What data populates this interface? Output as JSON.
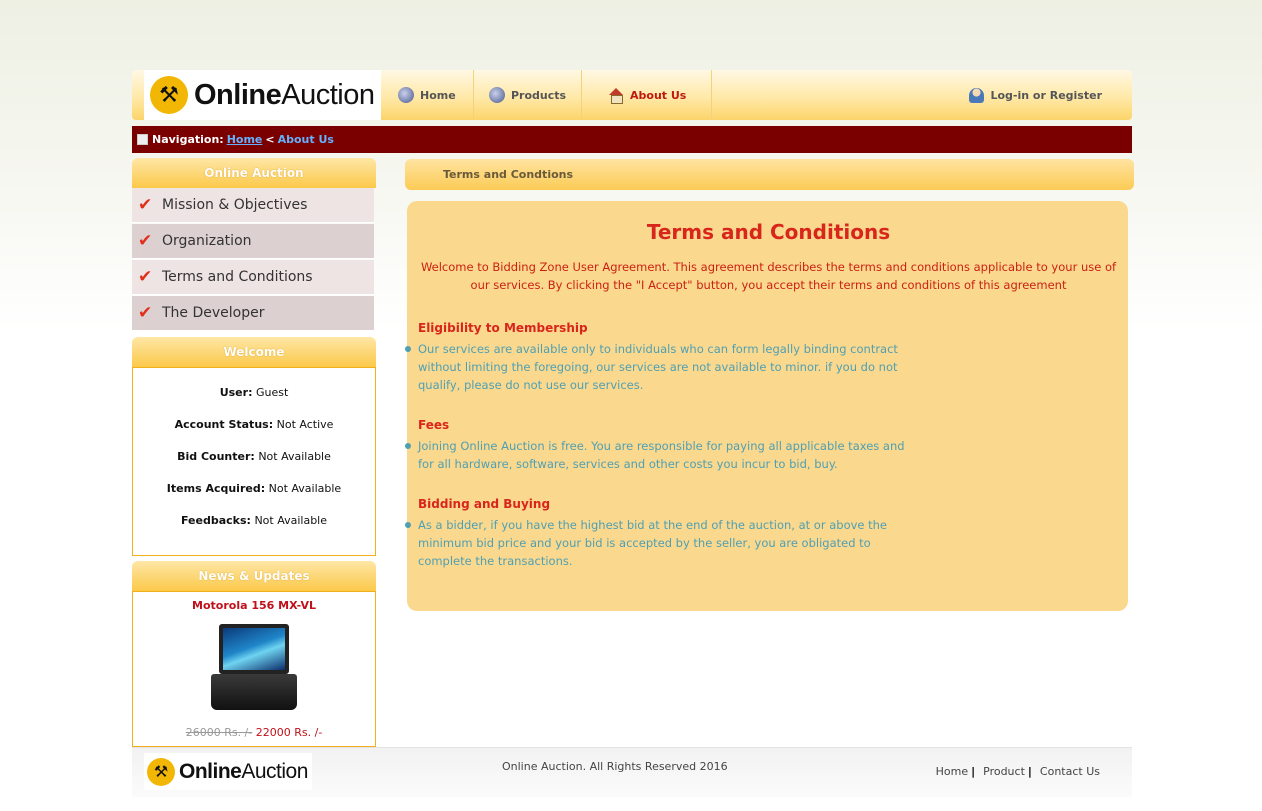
{
  "header": {
    "logo_primary": "Online",
    "logo_secondary": "Auction",
    "nav": [
      {
        "label": "Home"
      },
      {
        "label": "Products"
      },
      {
        "label": "About Us"
      }
    ],
    "login_label": "Log-in or Register"
  },
  "breadcrumb": {
    "prefix": "Navigation:",
    "home": "Home",
    "separator": "<",
    "current": "About Us"
  },
  "sidebar": {
    "menu_title": "Online Auction",
    "menu_items": [
      {
        "label": "Mission & Objectives"
      },
      {
        "label": "Organization"
      },
      {
        "label": "Terms and Conditions"
      },
      {
        "label": "The Developer"
      }
    ],
    "welcome_title": "Welcome",
    "stats": [
      {
        "label": "User:",
        "value": "Guest"
      },
      {
        "label": "Account Status:",
        "value": "Not Active"
      },
      {
        "label": "Bid Counter:",
        "value": "Not Available"
      },
      {
        "label": "Items Acquired:",
        "value": "Not Available"
      },
      {
        "label": "Feedbacks:",
        "value": "Not Available"
      }
    ],
    "news_title": "News & Updates",
    "news_item": {
      "name": "Motorola 156 MX-VL",
      "old_price": "26000 Rs. /-",
      "new_price": "22000 Rs. /-"
    }
  },
  "content": {
    "header_label": "Terms and Condtions",
    "title": "Terms and Conditions",
    "intro": "Welcome to Bidding Zone User Agreement. This agreement describes the terms and conditions applicable to your use of our services. By clicking the \"I Accept\" button, you accept their terms and conditions of this agreement",
    "sections": [
      {
        "title": "Eligibility to Membership",
        "body": "Our services are available only to individuals who can form legally binding contract without limiting the foregoing, our services are not available to minor. if you do not qualify, please do not use our services."
      },
      {
        "title": "Fees",
        "body": "Joining Online Auction is free. You are responsible for paying all applicable taxes and for all hardware, software, services and other costs you incur to bid, buy."
      },
      {
        "title": "Bidding and Buying",
        "body": "As a bidder, if you have the highest bid at the end of the auction, at or above the minimum bid price and your bid is accepted by the seller, you are obligated to complete the transactions."
      }
    ]
  },
  "footer": {
    "logo_primary": "Online",
    "logo_secondary": "Auction",
    "copyright": "Online Auction. All Rights Reserved 2016",
    "links": [
      {
        "label": "Home"
      },
      {
        "label": "Product"
      },
      {
        "label": "Contact Us"
      }
    ]
  },
  "colors": {
    "accent": "#fbcb55",
    "breadcrumb_bg": "#7a0000",
    "title_red": "#d9261c",
    "body_teal": "#4f9fb3"
  }
}
